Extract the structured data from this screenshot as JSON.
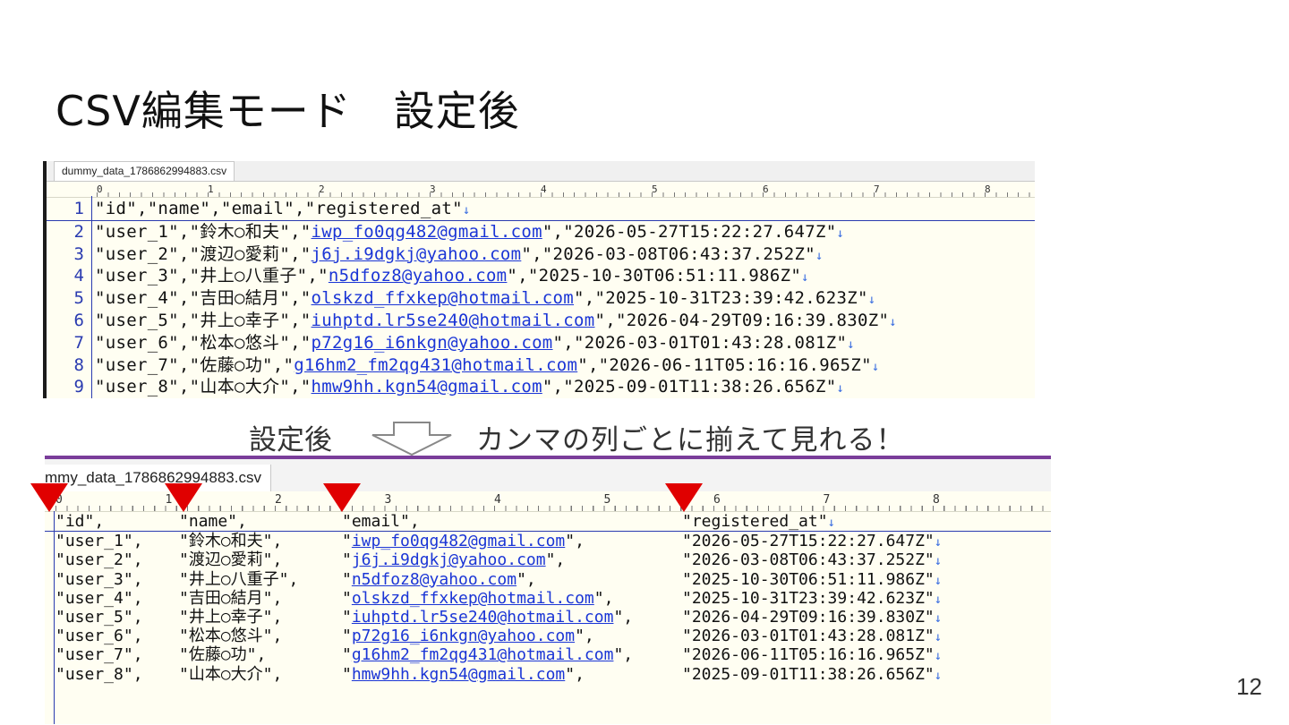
{
  "slide": {
    "title": "CSV編集モード　設定後",
    "page_number": "12"
  },
  "top_editor": {
    "tab_label": "dummy_data_1786862994883.csv",
    "ruler_labels": [
      "0",
      "1",
      "2",
      "3",
      "4",
      "5",
      "6",
      "7",
      "8"
    ],
    "rows": [
      {
        "no": "1",
        "pre": "\"id\",\"name\",\"email\",\"registered_at\"",
        "email": "",
        "post": "",
        "eol": "↓"
      },
      {
        "no": "2",
        "pre": "\"user_1\",\"鈴木○和夫\",\"",
        "email": "iwp_fo0qg482@gmail.com",
        "post": "\",\"2026-05-27T15:22:27.647Z\"",
        "eol": "↓"
      },
      {
        "no": "3",
        "pre": "\"user_2\",\"渡辺○愛莉\",\"",
        "email": "j6j.i9dgkj@yahoo.com",
        "post": "\",\"2026-03-08T06:43:37.252Z\"",
        "eol": "↓"
      },
      {
        "no": "4",
        "pre": "\"user_3\",\"井上○八重子\",\"",
        "email": "n5dfoz8@yahoo.com",
        "post": "\",\"2025-10-30T06:51:11.986Z\"",
        "eol": "↓"
      },
      {
        "no": "5",
        "pre": "\"user_4\",\"吉田○結月\",\"",
        "email": "olskzd_ffxkep@hotmail.com",
        "post": "\",\"2025-10-31T23:39:42.623Z\"",
        "eol": "↓"
      },
      {
        "no": "6",
        "pre": "\"user_5\",\"井上○幸子\",\"",
        "email": "iuhptd.lr5se240@hotmail.com",
        "post": "\",\"2026-04-29T09:16:39.830Z\"",
        "eol": "↓"
      },
      {
        "no": "7",
        "pre": "\"user_6\",\"松本○悠斗\",\"",
        "email": "p72g16_i6nkgn@yahoo.com",
        "post": "\",\"2026-03-01T01:43:28.081Z\"",
        "eol": "↓"
      },
      {
        "no": "8",
        "pre": "\"user_7\",\"佐藤○功\",\"",
        "email": "g16hm2_fm2qg431@hotmail.com",
        "post": "\",\"2026-06-11T05:16:16.965Z\"",
        "eol": "↓"
      },
      {
        "no": "9",
        "pre": "\"user_8\",\"山本○大介\",\"",
        "email": "hmw9hh.kgn54@gmail.com",
        "post": "\",\"2025-09-01T11:38:26.656Z\"",
        "eol": "↓"
      }
    ]
  },
  "caption": {
    "left": "設定後",
    "right": "カンマの列ごとに揃えて見れる！",
    "arrow_icon": "down-arrow-outline-icon"
  },
  "bottom_editor": {
    "tab_label": "mmy_data_1786862994883.csv",
    "ruler_labels": [
      "0",
      "1",
      "2",
      "3",
      "4",
      "5",
      "6",
      "7",
      "8"
    ],
    "marker_color": "#e00000",
    "rows": [
      {
        "c0": "\"id\",",
        "c1": "\"name\",",
        "email": "",
        "c2": "\"email\",",
        "c3": "\"registered_at\"",
        "eol": "↓"
      },
      {
        "c0": "\"user_1\",",
        "c1": "\"鈴木○和夫\",",
        "email": "iwp_fo0qg482@gmail.com",
        "c2q": "\"",
        "c2e": "\",",
        "c3": "\"2026-05-27T15:22:27.647Z\"",
        "eol": "↓"
      },
      {
        "c0": "\"user_2\",",
        "c1": "\"渡辺○愛莉\",",
        "email": "j6j.i9dgkj@yahoo.com",
        "c2q": "\"",
        "c2e": "\",",
        "c3": "\"2026-03-08T06:43:37.252Z\"",
        "eol": "↓"
      },
      {
        "c0": "\"user_3\",",
        "c1": "\"井上○八重子\",",
        "email": "n5dfoz8@yahoo.com",
        "c2q": "\"",
        "c2e": "\",",
        "c3": "\"2025-10-30T06:51:11.986Z\"",
        "eol": "↓"
      },
      {
        "c0": "\"user_4\",",
        "c1": "\"吉田○結月\",",
        "email": "olskzd_ffxkep@hotmail.com",
        "c2q": "\"",
        "c2e": "\",",
        "c3": "\"2025-10-31T23:39:42.623Z\"",
        "eol": "↓"
      },
      {
        "c0": "\"user_5\",",
        "c1": "\"井上○幸子\",",
        "email": "iuhptd.lr5se240@hotmail.com",
        "c2q": "\"",
        "c2e": "\",",
        "c3": "\"2026-04-29T09:16:39.830Z\"",
        "eol": "↓"
      },
      {
        "c0": "\"user_6\",",
        "c1": "\"松本○悠斗\",",
        "email": "p72g16_i6nkgn@yahoo.com",
        "c2q": "\"",
        "c2e": "\",",
        "c3": "\"2026-03-01T01:43:28.081Z\"",
        "eol": "↓"
      },
      {
        "c0": "\"user_7\",",
        "c1": "\"佐藤○功\",",
        "email": "g16hm2_fm2qg431@hotmail.com",
        "c2q": "\"",
        "c2e": "\",",
        "c3": "\"2026-06-11T05:16:16.965Z\"",
        "eol": "↓"
      },
      {
        "c0": "\"user_8\",",
        "c1": "\"山本○大介\",",
        "email": "hmw9hh.kgn54@gmail.com",
        "c2q": "\"",
        "c2e": "\",",
        "c3": "\"2025-09-01T11:38:26.656Z\"",
        "eol": "↓"
      }
    ]
  }
}
